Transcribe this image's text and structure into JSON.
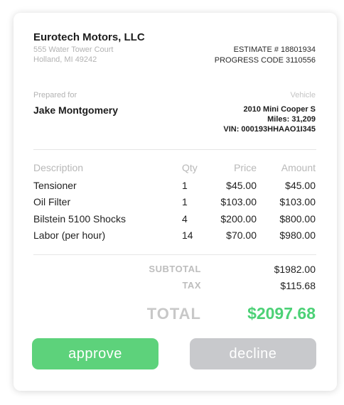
{
  "company": {
    "name": "Eurotech Motors, LLC",
    "address_line1": "555 Water Tower Court",
    "address_line2": "Holland, MI 49242"
  },
  "estimate": {
    "number_text": "ESTIMATE # 18801934",
    "progress_text": "PROGRESS CODE 3110556"
  },
  "customer": {
    "label": "Prepared  for",
    "name": "Jake Montgomery"
  },
  "vehicle": {
    "label": "Vehicle",
    "model": "2010 Mini Cooper S",
    "miles": "Miles: 31,209",
    "vin": "VIN: 000193HHAAO1I345"
  },
  "table": {
    "headers": {
      "description": "Description",
      "qty": "Qty",
      "price": "Price",
      "amount": "Amount"
    },
    "rows": [
      {
        "description": "Tensioner",
        "qty": "1",
        "price": "$45.00",
        "amount": "$45.00"
      },
      {
        "description": "Oil Filter",
        "qty": "1",
        "price": "$103.00",
        "amount": "$103.00"
      },
      {
        "description": "Bilstein 5100 Shocks",
        "qty": "4",
        "price": "$200.00",
        "amount": "$800.00"
      },
      {
        "description": "Labor (per hour)",
        "qty": "14",
        "price": "$70.00",
        "amount": "$980.00"
      }
    ]
  },
  "summary": {
    "subtotal_label": "SUBTOTAL",
    "subtotal_value": "$1982.00",
    "tax_label": "TAX",
    "tax_value": "$115.68",
    "total_label": "TOTAL",
    "total_value": "$2097.68"
  },
  "actions": {
    "approve_label": "approve",
    "decline_label": "decline"
  },
  "colors": {
    "accent_green": "#4cd176",
    "approve_button": "#5dd27b",
    "decline_button": "#c8c9cc"
  }
}
